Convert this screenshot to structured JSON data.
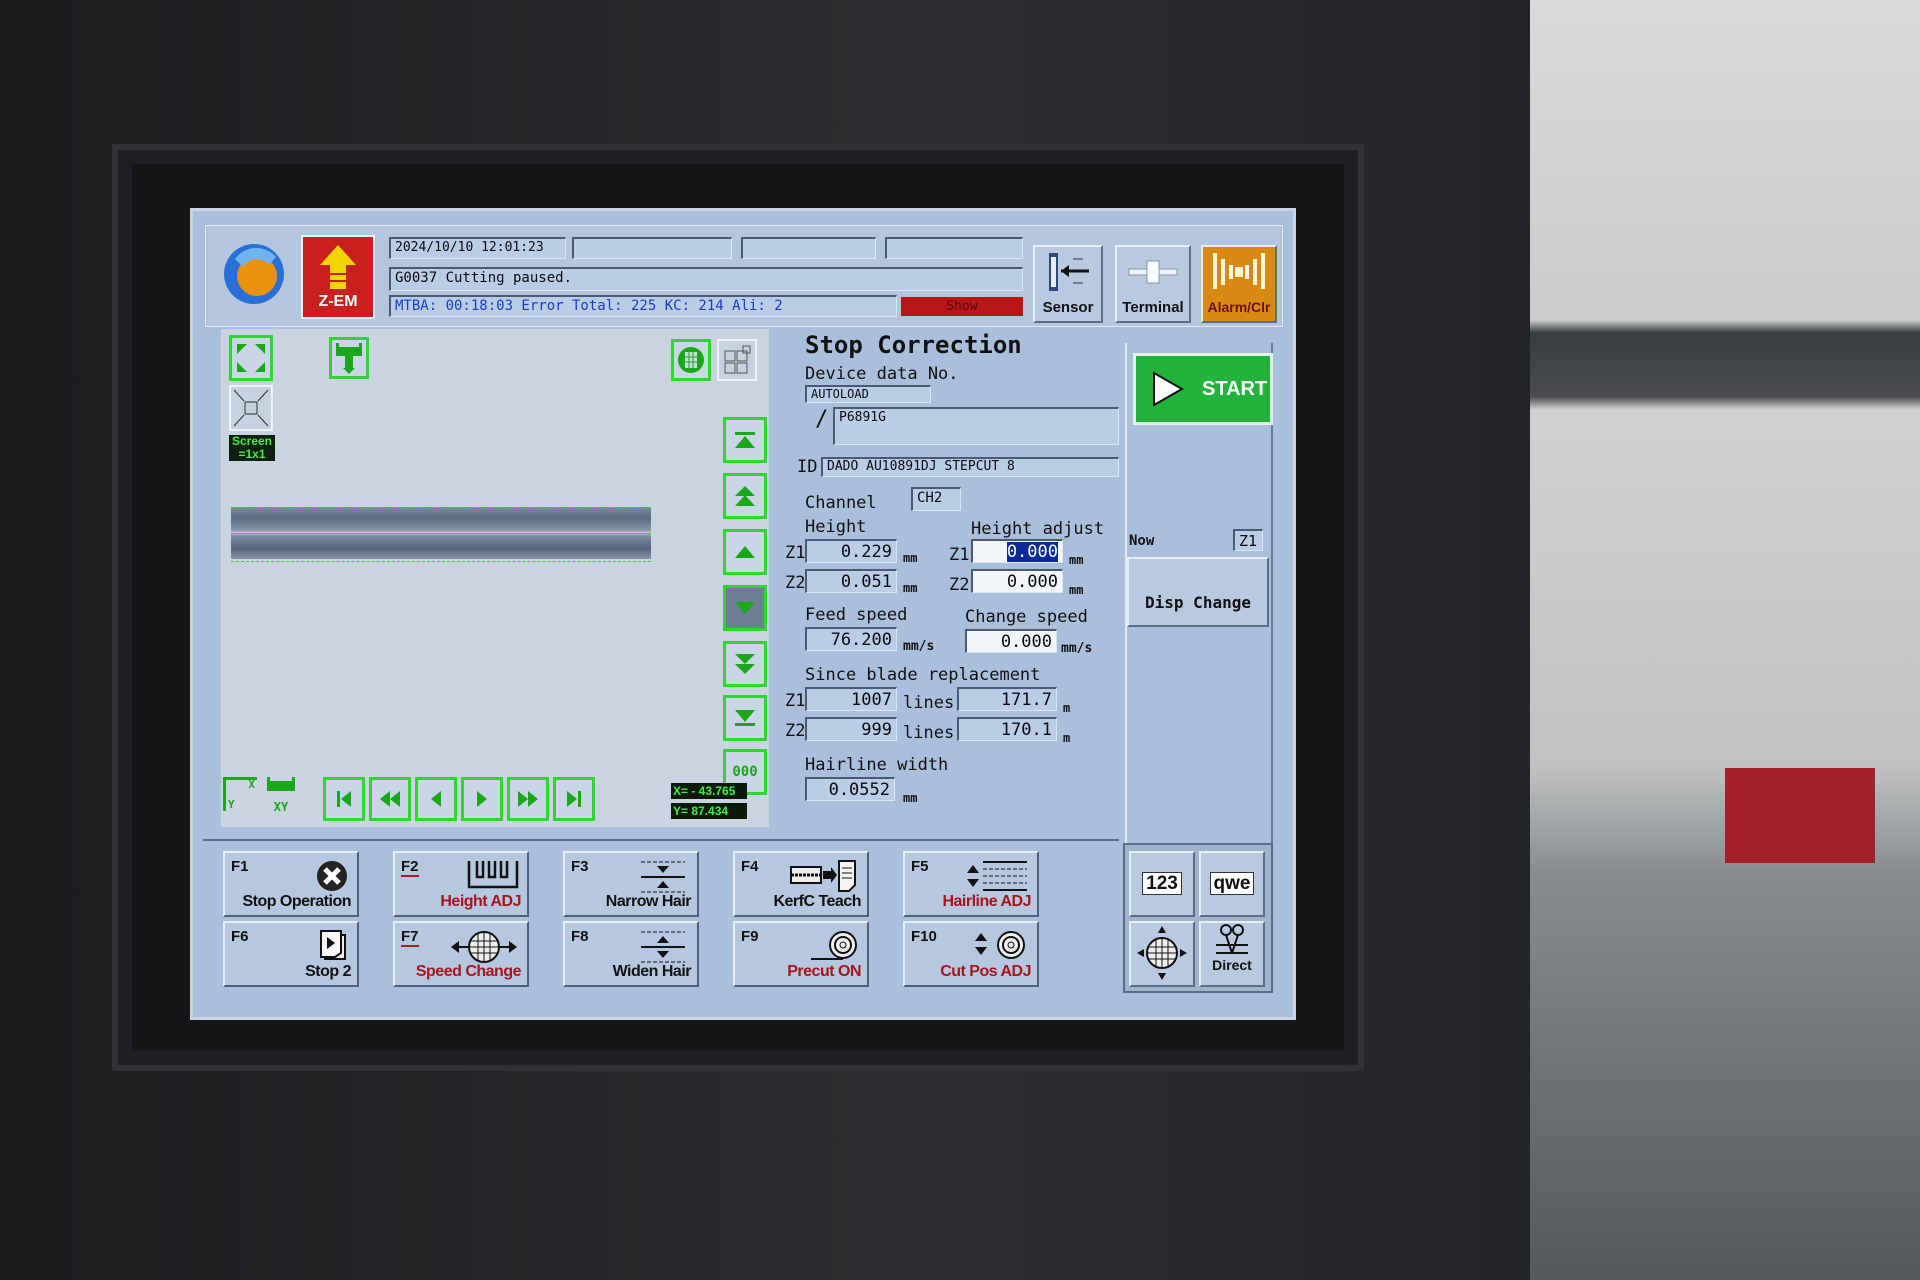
{
  "header": {
    "datetime": "2024/10/10 12:01:23",
    "message": "G0037  Cutting paused.",
    "status_line": "MTBA: 00:18:03 Error Total: 225 KC: 214 Ali: 2",
    "show_label": "Show",
    "z_em_label": "Z-EM",
    "sensor_label": "Sensor",
    "terminal_label": "Terminal",
    "alarm_label": "Alarm/Clr"
  },
  "camera": {
    "screen_label": "Screen",
    "screen_scale": "=1x1",
    "x_readout": "X= - 43.765",
    "y_readout": "Y= 87.434",
    "axis_x": "X",
    "axis_y": "Y",
    "xy_label": "XY",
    "index_label": "000"
  },
  "form": {
    "title": "Stop Correction",
    "device_data_label": "Device data No.",
    "device_data_value": "AUTOLOAD",
    "device_sub_value": "P6891G",
    "slash": "/",
    "id_label": "ID",
    "id_value": "DADO AU10891DJ STEPCUT 8",
    "channel_label": "Channel",
    "channel_value": "CH2",
    "height_label": "Height",
    "height_adjust_label": "Height adjust",
    "z1": "Z1",
    "z2": "Z2",
    "height_z1": "0.229",
    "height_z2": "0.051",
    "adjust_z1": "0.000",
    "adjust_z2": "0.000",
    "mm": "mm",
    "feed_speed_label": "Feed speed",
    "feed_speed": "76.200",
    "change_speed_label": "Change speed",
    "change_speed": "0.000",
    "mm_s": "mm/s",
    "blade_label": "Since blade replacement",
    "lines_z1": "1007",
    "lines_z2": "999",
    "lines": "lines",
    "dist_z1": "171.7",
    "dist_z2": "170.1",
    "m": "m",
    "hairline_label": "Hairline width",
    "hairline_value": "0.0552"
  },
  "side": {
    "start_label": "START",
    "now_label": "Now",
    "now_value": "Z1",
    "disp_change_label": "Disp Change"
  },
  "fkeys": [
    {
      "key": "F1",
      "label": "Stop Operation",
      "red": false,
      "icon": "stop-x-icon"
    },
    {
      "key": "F2",
      "label": "Height ADJ",
      "red": true,
      "icon": "height-wave-icon"
    },
    {
      "key": "F3",
      "label": "Narrow Hair",
      "red": false,
      "icon": "narrow-hairline-icon"
    },
    {
      "key": "F4",
      "label": "KerfC Teach",
      "red": false,
      "icon": "kerf-teach-icon"
    },
    {
      "key": "F5",
      "label": "Hairline ADJ",
      "red": true,
      "icon": "hairline-adjust-icon"
    },
    {
      "key": "F6",
      "label": "Stop 2",
      "red": false,
      "icon": "stop2-page-icon"
    },
    {
      "key": "F7",
      "label": "Speed Change",
      "red": true,
      "icon": "wafer-arrows-icon"
    },
    {
      "key": "F8",
      "label": "Widen Hair",
      "red": false,
      "icon": "widen-hairline-icon"
    },
    {
      "key": "F9",
      "label": "Precut ON",
      "red": true,
      "icon": "blade-roll-icon"
    },
    {
      "key": "F10",
      "label": "Cut Pos ADJ",
      "red": true,
      "icon": "cut-pos-icon"
    }
  ],
  "keypad": {
    "numeric_label": "123",
    "alpha_label": "qwe",
    "direct_label": "Direct"
  },
  "colors": {
    "screen_bg": "#a9bfdb",
    "accent_green": "#2fd62f",
    "start_green": "#22b33a",
    "alarm_orange": "#d98a12",
    "zem_red": "#c8201c",
    "status_blue": "#1a3cc8"
  }
}
